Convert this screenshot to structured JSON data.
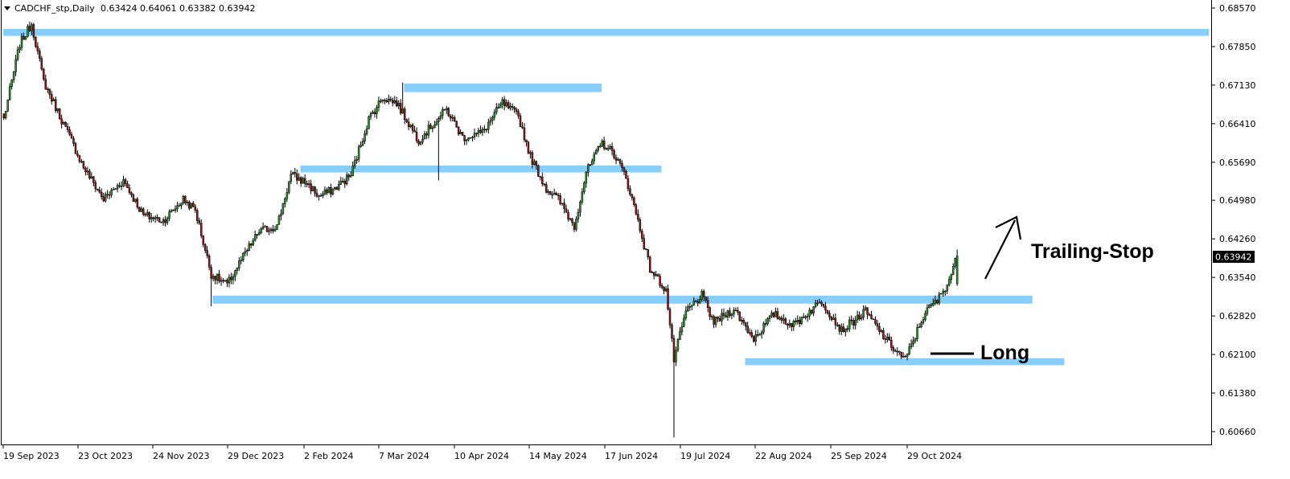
{
  "header": {
    "symbol_label": "CADCHF_stp,Daily",
    "ohlc_text": "0.63424 0.64061 0.63382 0.63942"
  },
  "colors": {
    "bull_candle": "#2e8b2e",
    "bear_candle": "#8b1a1a",
    "zone_fill": "#87cefa",
    "background": "#ffffff",
    "axis": "#000000"
  },
  "chart_data": {
    "type": "candlestick",
    "symbol": "CADCHF_stp",
    "timeframe": "Daily",
    "last_price_label": "0.63942",
    "last_candle": {
      "open": 0.63424,
      "high": 0.64061,
      "low": 0.63382,
      "close": 0.63942
    },
    "ylim": [
      0.603,
      0.6885
    ],
    "y_ticks": [
      "0.68570",
      "0.67850",
      "0.67130",
      "0.66410",
      "0.65690",
      "0.64980",
      "0.64260",
      "0.63540",
      "0.62820",
      "0.62100",
      "0.61380",
      "0.60660"
    ],
    "x_ticks": [
      "19 Sep 2023",
      "23 Oct 2023",
      "24 Nov 2023",
      "29 Dec 2023",
      "2 Feb 2024",
      "7 Mar 2024",
      "10 Apr 2024",
      "14 May 2024",
      "17 Jun 2024",
      "19 Jul 2024",
      "22 Aug 2024",
      "25 Sep 2024",
      "29 Oct 2024"
    ],
    "price_path": [
      [
        0,
        0.665
      ],
      [
        8,
        0.679
      ],
      [
        14,
        0.6828
      ],
      [
        20,
        0.672
      ],
      [
        30,
        0.664
      ],
      [
        40,
        0.656
      ],
      [
        50,
        0.65
      ],
      [
        60,
        0.6535
      ],
      [
        70,
        0.647
      ],
      [
        80,
        0.646
      ],
      [
        90,
        0.65
      ],
      [
        96,
        0.648
      ],
      [
        104,
        0.636
      ],
      [
        112,
        0.634
      ],
      [
        118,
        0.638
      ],
      [
        128,
        0.644
      ],
      [
        137,
        0.645
      ],
      [
        144,
        0.6545
      ],
      [
        152,
        0.653
      ],
      [
        158,
        0.6505
      ],
      [
        166,
        0.652
      ],
      [
        174,
        0.6545
      ],
      [
        183,
        0.665
      ],
      [
        190,
        0.669
      ],
      [
        197,
        0.668
      ],
      [
        208,
        0.661
      ],
      [
        222,
        0.6668
      ],
      [
        230,
        0.6615
      ],
      [
        240,
        0.6625
      ],
      [
        250,
        0.668
      ],
      [
        258,
        0.6655
      ],
      [
        264,
        0.658
      ],
      [
        272,
        0.652
      ],
      [
        278,
        0.65
      ],
      [
        286,
        0.645
      ],
      [
        292,
        0.655
      ],
      [
        300,
        0.6605
      ],
      [
        306,
        0.6585
      ],
      [
        312,
        0.654
      ],
      [
        318,
        0.646
      ],
      [
        324,
        0.637
      ],
      [
        332,
        0.633
      ],
      [
        336,
        0.62
      ],
      [
        342,
        0.629
      ],
      [
        350,
        0.632
      ],
      [
        356,
        0.627
      ],
      [
        366,
        0.6295
      ],
      [
        376,
        0.624
      ],
      [
        386,
        0.6285
      ],
      [
        396,
        0.6265
      ],
      [
        410,
        0.631
      ],
      [
        420,
        0.6255
      ],
      [
        432,
        0.629
      ],
      [
        444,
        0.623
      ],
      [
        452,
        0.62
      ],
      [
        462,
        0.629
      ],
      [
        468,
        0.631
      ],
      [
        474,
        0.635
      ],
      [
        478,
        0.6394
      ]
    ],
    "wick_extremes": [
      {
        "i": 14,
        "high": 0.683
      },
      {
        "i": 104,
        "low": 0.63
      },
      {
        "i": 200,
        "high": 0.6718
      },
      {
        "i": 218,
        "low": 0.6535
      },
      {
        "i": 336,
        "low": 0.6055
      }
    ],
    "zones": [
      {
        "start_i": 0,
        "end_i": 1600,
        "y_low": 0.6805,
        "y_high": 0.6818
      },
      {
        "start_i": 201,
        "end_i": 300,
        "y_low": 0.67,
        "y_high": 0.6716
      },
      {
        "start_i": 149,
        "end_i": 330,
        "y_low": 0.655,
        "y_high": 0.6563
      },
      {
        "start_i": 105,
        "end_i": 516,
        "y_low": 0.6305,
        "y_high": 0.632
      },
      {
        "start_i": 372,
        "end_i": 532,
        "y_low": 0.619,
        "y_high": 0.6203
      }
    ],
    "annotations": [
      {
        "text": "Trailing-Stop",
        "kind": "label"
      },
      {
        "text": "Long",
        "kind": "label"
      }
    ]
  }
}
